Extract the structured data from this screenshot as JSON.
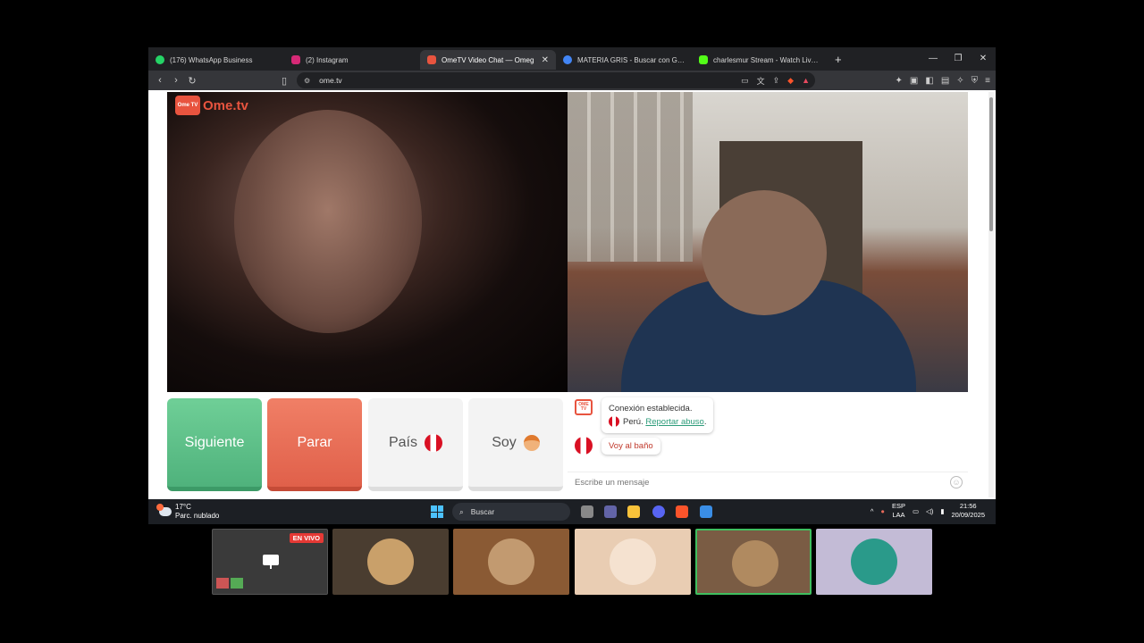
{
  "browser": {
    "tabs": [
      {
        "title": "(176) WhatsApp Business",
        "icon": "whatsapp-icon",
        "color": "#25d366",
        "active": false
      },
      {
        "title": "(2) Instagram",
        "icon": "instagram-icon",
        "color": "#d62976",
        "active": false
      },
      {
        "title": "OmeTV Video Chat — Omeg",
        "icon": "ometv-icon",
        "color": "#e8543f",
        "active": true
      },
      {
        "title": "MATERIA GRIS - Buscar con Google",
        "icon": "google-icon",
        "color": "#4285f4",
        "active": false
      },
      {
        "title": "charlesmur Stream - Watch Live on K",
        "icon": "kick-icon",
        "color": "#53fc18",
        "active": false
      }
    ],
    "url": "ome.tv"
  },
  "page": {
    "logo_text": "Ome.tv",
    "logo_badge": "Ome TV",
    "buttons": {
      "next": "Siguiente",
      "stop": "Parar",
      "country": "País",
      "me": "Soy"
    },
    "chat": {
      "connection": "Conexión establecida.",
      "country": "Perú.",
      "report": "Reportar abuso",
      "report_suffix": ".",
      "message": "Voy al baño",
      "input_placeholder": "Escribe un mensaje"
    }
  },
  "taskbar": {
    "temperature": "17°C",
    "weather": "Parc. nublado",
    "search": "Buscar",
    "lang_line1": "ESP",
    "lang_line2": "LAA",
    "time": "21:56",
    "date": "20/09/2025"
  },
  "participants": {
    "live_badge": "EN VIVO"
  },
  "colors": {
    "accent": "#e8543f",
    "next_green": "#4fb27c",
    "stop_red": "#e0604a",
    "link_green": "#2d9c7a",
    "active_speaker": "#3fbf5f"
  }
}
